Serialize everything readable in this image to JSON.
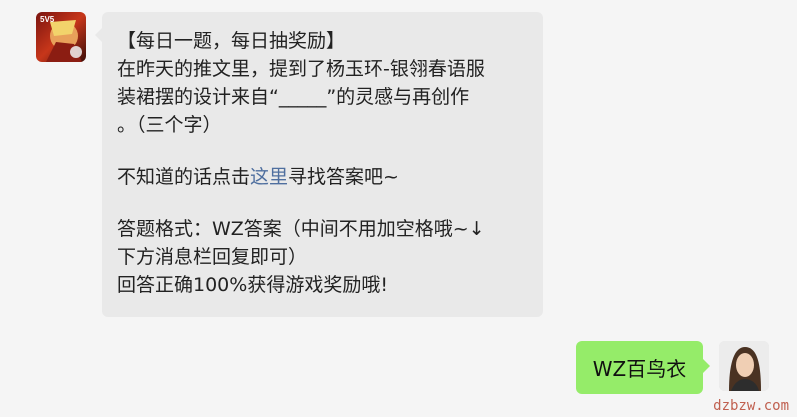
{
  "bot_message": {
    "title": "【每日一题，每日抽奖励】",
    "line1": "在昨天的推文里，提到了杨玉环-银翎春语服",
    "line2": "装裙摆的设计来自“_____”的灵感与再创作",
    "line3": "。（三个字）",
    "hint_before": "不知道的话点击",
    "hint_link": "这里",
    "hint_after": "寻找答案吧~",
    "format_line1": "答题格式：WZ答案（中间不用加空格哦~↓",
    "format_line2": "下方消息栏回复即可）",
    "reward_line": "回答正确100%获得游戏奖励哦!"
  },
  "user_message": {
    "text": "WZ百鸟衣"
  },
  "avatar_badge": "5V5",
  "watermark": "dzbzw.com",
  "colors": {
    "user_bubble": "#95ec69",
    "bot_bubble": "#e9e9e9",
    "link": "#4f6f9f"
  }
}
